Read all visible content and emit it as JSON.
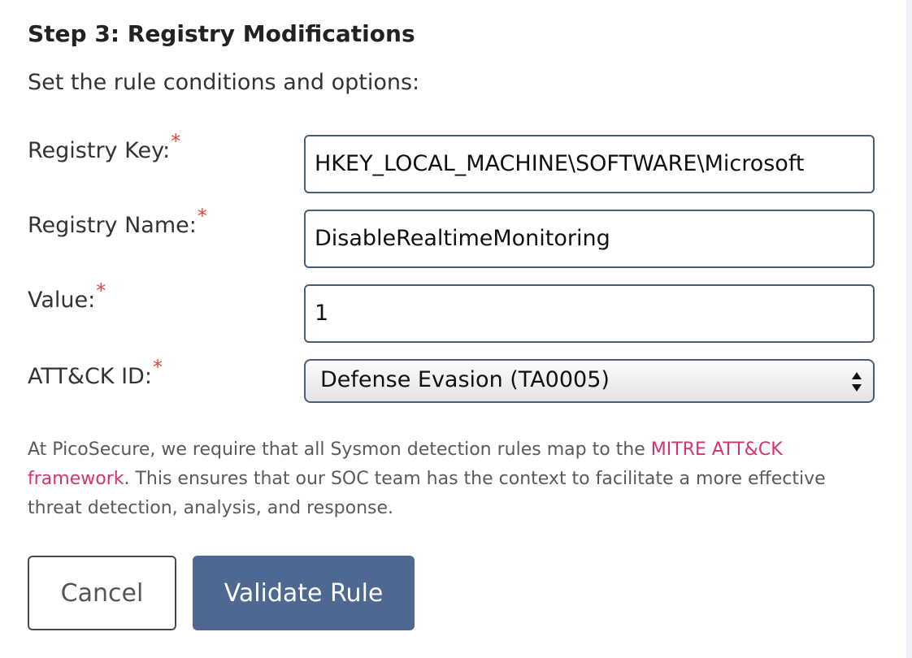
{
  "step": {
    "title": "Step 3: Registry Modifications",
    "subtitle": "Set the rule conditions and options:"
  },
  "form": {
    "required_marker": "*",
    "registry_key": {
      "label": "Registry Key:",
      "value": "HKEY_LOCAL_MACHINE\\SOFTWARE\\Microsoft"
    },
    "registry_name": {
      "label": "Registry Name:",
      "value": "DisableRealtimeMonitoring"
    },
    "value": {
      "label": "Value:",
      "value": "1"
    },
    "attack_id": {
      "label": "ATT&CK ID:",
      "selected": "Defense Evasion (TA0005)"
    }
  },
  "note": {
    "text_before": "At PicoSecure, we require that all Sysmon detection rules map to the ",
    "link_text": "MITRE ATT&CK framework",
    "text_after": ". This ensures that our SOC team has the context to facilitate a more effective threat detection, analysis, and response."
  },
  "buttons": {
    "cancel": "Cancel",
    "validate": "Validate Rule"
  },
  "colors": {
    "accent": "#4f6891",
    "link": "#d6336c",
    "required": "#e2453c",
    "field_border": "#4c5d7a"
  },
  "icons": {
    "select_arrows": "up-down-arrows-icon"
  }
}
